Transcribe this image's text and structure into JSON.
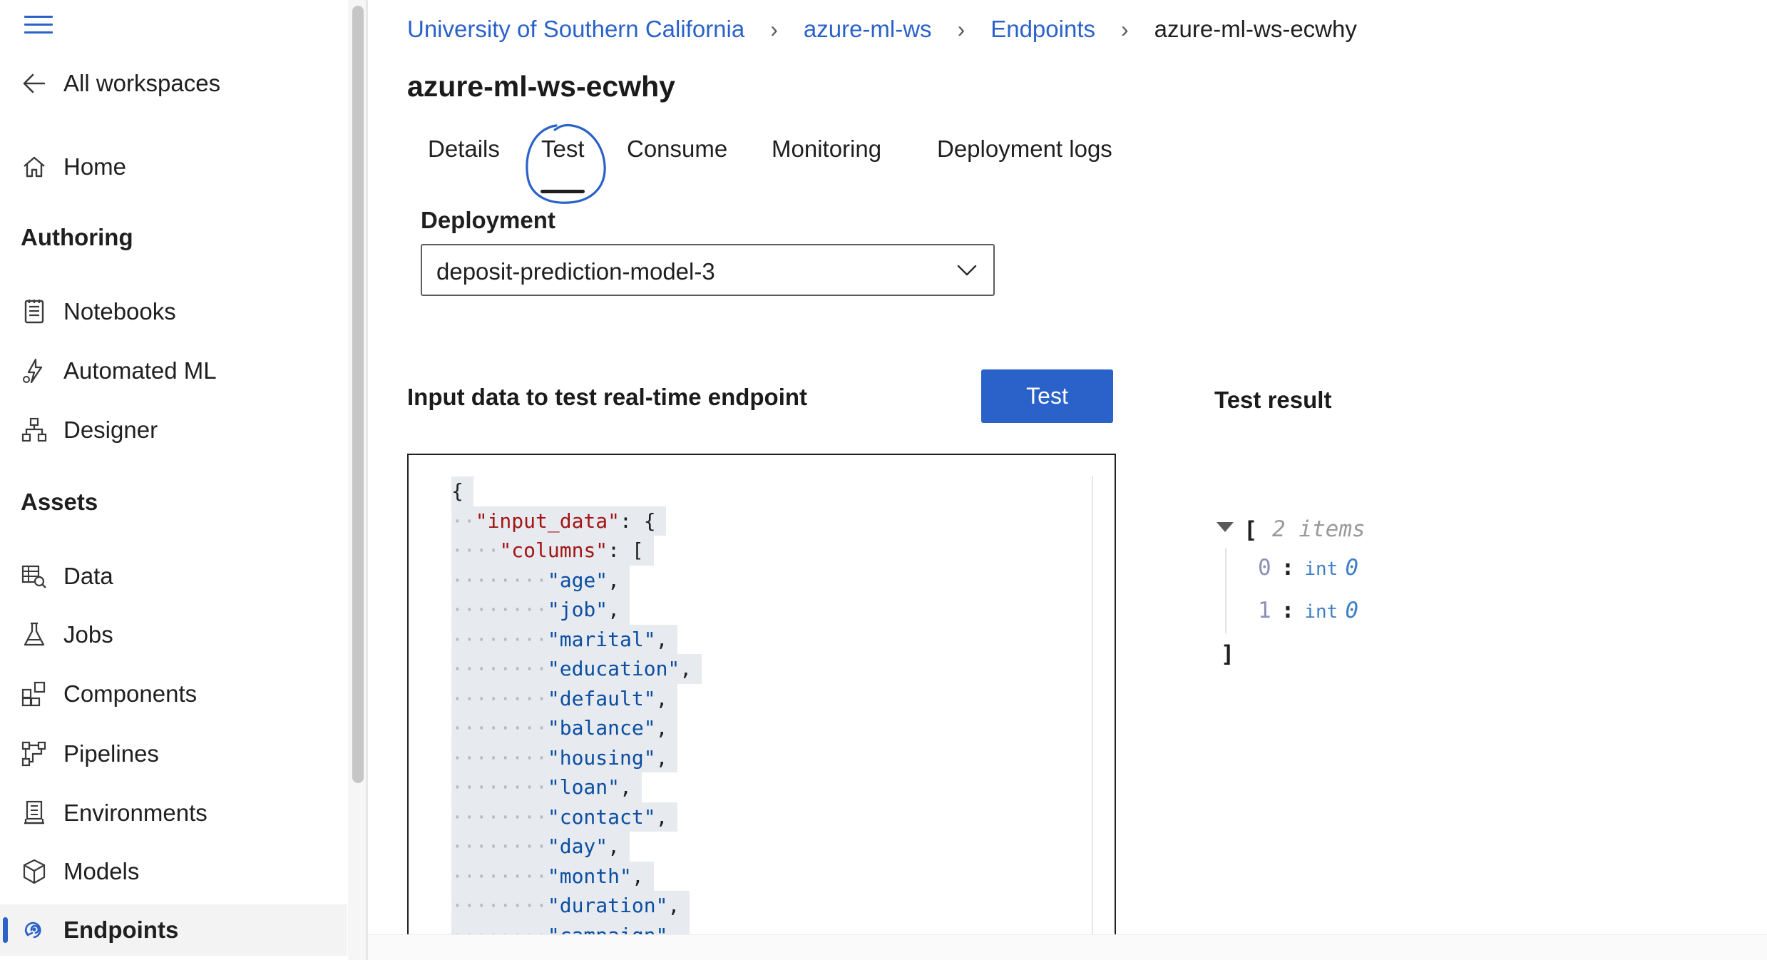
{
  "sidebar": {
    "back_label": "All workspaces",
    "home_label": "Home",
    "sections": {
      "authoring": "Authoring",
      "assets": "Assets"
    },
    "authoring_items": [
      {
        "label": "Notebooks",
        "icon": "notebook-icon"
      },
      {
        "label": "Automated ML",
        "icon": "automated-ml-icon"
      },
      {
        "label": "Designer",
        "icon": "designer-icon"
      }
    ],
    "asset_items": [
      {
        "label": "Data",
        "icon": "data-icon"
      },
      {
        "label": "Jobs",
        "icon": "flask-icon"
      },
      {
        "label": "Components",
        "icon": "components-icon"
      },
      {
        "label": "Pipelines",
        "icon": "pipelines-icon"
      },
      {
        "label": "Environments",
        "icon": "environment-icon"
      },
      {
        "label": "Models",
        "icon": "cube-icon"
      },
      {
        "label": "Endpoints",
        "icon": "endpoint-icon",
        "active": true
      }
    ]
  },
  "breadcrumb": {
    "items": [
      "University of Southern California",
      "azure-ml-ws",
      "Endpoints"
    ],
    "current": "azure-ml-ws-ecwhy"
  },
  "page": {
    "title": "azure-ml-ws-ecwhy"
  },
  "tabs": [
    {
      "label": "Details"
    },
    {
      "label": "Test",
      "selected": true
    },
    {
      "label": "Consume"
    },
    {
      "label": "Monitoring"
    },
    {
      "label": "Deployment logs"
    }
  ],
  "deployment": {
    "label": "Deployment",
    "value": "deposit-prediction-model-3"
  },
  "input_section": {
    "title": "Input data to test real-time endpoint",
    "test_button": "Test"
  },
  "code_lines": [
    {
      "indent": "",
      "key": "",
      "punct": "{"
    },
    {
      "indent": "··",
      "key": "\"input_data\"",
      "punct": ": {"
    },
    {
      "indent": "····",
      "key": "\"columns\"",
      "punct": ": ["
    },
    {
      "indent": "········",
      "str": "\"age\"",
      "punct": ","
    },
    {
      "indent": "········",
      "str": "\"job\"",
      "punct": ","
    },
    {
      "indent": "········",
      "str": "\"marital\"",
      "punct": ","
    },
    {
      "indent": "········",
      "str": "\"education\"",
      "punct": ","
    },
    {
      "indent": "········",
      "str": "\"default\"",
      "punct": ","
    },
    {
      "indent": "········",
      "str": "\"balance\"",
      "punct": ","
    },
    {
      "indent": "········",
      "str": "\"housing\"",
      "punct": ","
    },
    {
      "indent": "········",
      "str": "\"loan\"",
      "punct": ","
    },
    {
      "indent": "········",
      "str": "\"contact\"",
      "punct": ","
    },
    {
      "indent": "········",
      "str": "\"day\"",
      "punct": ","
    },
    {
      "indent": "········",
      "str": "\"month\"",
      "punct": ","
    },
    {
      "indent": "········",
      "str": "\"duration\"",
      "punct": ","
    },
    {
      "indent": "········",
      "str": "\"campaign\"",
      "punct": ","
    }
  ],
  "test_result": {
    "title": "Test result",
    "open_bracket": "[",
    "count_label": "2 items",
    "close_bracket": "]",
    "items": [
      {
        "index": "0",
        "type": "int",
        "value": "0"
      },
      {
        "index": "1",
        "type": "int",
        "value": "0"
      }
    ]
  },
  "colors": {
    "accent": "#2a62c9",
    "annotation_circle": "#2a62c9"
  }
}
